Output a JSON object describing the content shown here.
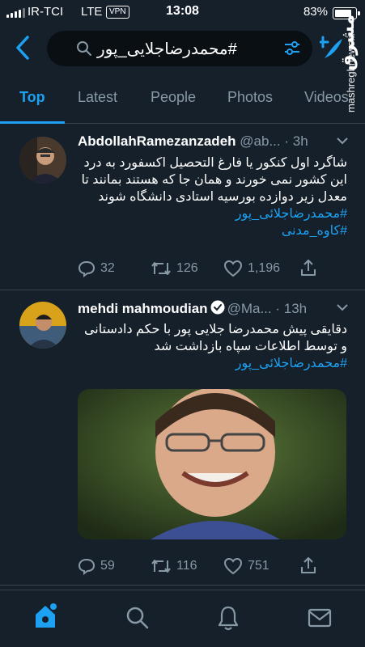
{
  "status_bar": {
    "carrier": "IR-TCI",
    "network": "LTE",
    "vpn": "VPN",
    "time": "13:08",
    "battery": "83%"
  },
  "search": {
    "query": "#محمدرضاجلایی_پور",
    "icons": [
      "back-chevron-icon",
      "search-icon",
      "filter-icon",
      "compose-icon"
    ]
  },
  "watermark": {
    "logo": "مشرق",
    "site": "mashreghnews.ir"
  },
  "tabs": [
    {
      "label": "Top",
      "active": true
    },
    {
      "label": "Latest",
      "active": false
    },
    {
      "label": "People",
      "active": false
    },
    {
      "label": "Photos",
      "active": false
    },
    {
      "label": "Videos",
      "active": false
    }
  ],
  "tweets": [
    {
      "name": "AbdollahRamezanzadeh",
      "handle": "@ab...",
      "sep": "·",
      "time": "3h",
      "verified": false,
      "lines": [
        "شاگرد اول کنکور یا فارغ التحصیل اکسفورد به درد",
        "این کشور نمی خورند و همان جا که هستند بمانند تا",
        "معدل زیر دوازده بورسیه استادی دانشگاه شوند"
      ],
      "hashtags": [
        "#محمدرضاجلائی_پور",
        "#کاوه_مدنی"
      ],
      "replies": "32",
      "retweets": "126",
      "likes": "1,196"
    },
    {
      "name": "mehdi mahmoudian",
      "handle": "@Ma...",
      "sep": "·",
      "time": "13h",
      "verified": true,
      "lines": [
        "دقایقی پیش محمدرضا جلایی پور با حکم دادستانی",
        "و توسط اطلاعات سپاه بازداشت شد"
      ],
      "hashtags": [
        "#محمدرضاجلائی_پور"
      ],
      "replies": "59",
      "retweets": "116",
      "likes": "751"
    }
  ],
  "bottom_nav": [
    "home-icon",
    "search-icon",
    "notifications-icon",
    "messages-icon"
  ],
  "colors": {
    "background": "#15202b",
    "accent": "#1da1f2",
    "secondary_text": "#8899a6",
    "divider": "#38444d"
  }
}
